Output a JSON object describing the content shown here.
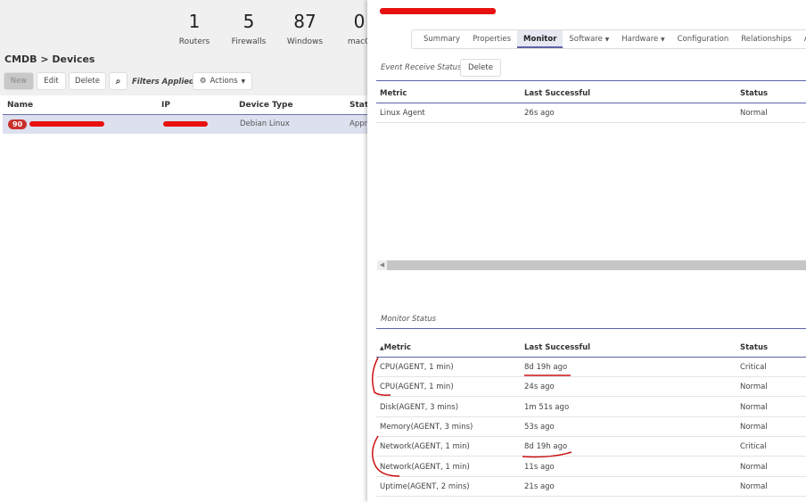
{
  "stats": [
    {
      "value": "1",
      "label": "Routers"
    },
    {
      "value": "5",
      "label": "Firewalls"
    },
    {
      "value": "87",
      "label": "Windows"
    },
    {
      "value": "0",
      "label": "macO"
    }
  ],
  "breadcrumb": "CMDB > Devices",
  "toolbar": {
    "new": "New",
    "edit": "Edit",
    "delete": "Delete",
    "search_icon": "search-icon",
    "filters": "Filters Applied",
    "actions": "Actions"
  },
  "devices": {
    "columns": [
      "Name",
      "IP",
      "Device Type",
      "Statu"
    ],
    "rows": [
      {
        "badge": "90",
        "name": "[redacted]",
        "ip": "[redacted]",
        "type": "Debian Linux",
        "status": "Appr"
      }
    ]
  },
  "detail": {
    "title": "[redacted]",
    "tabs": [
      "Summary",
      "Properties",
      "Monitor",
      "Software",
      "Hardware",
      "Configuration",
      "Relationships",
      "Agent Tem"
    ],
    "active_tab": "Monitor",
    "event": {
      "label": "Event Receive Status",
      "delete": "Delete",
      "columns": [
        "Metric",
        "Last Successful",
        "Status"
      ],
      "rows": [
        [
          "Linux Agent",
          "26s ago",
          "Normal"
        ]
      ]
    },
    "monitor": {
      "label": "Monitor Status",
      "columns": [
        "Metric",
        "Last Successful",
        "Status"
      ],
      "sort": "ascending by Metric",
      "rows": [
        [
          "CPU(AGENT, 1 min)",
          "8d 19h ago",
          "Critical"
        ],
        [
          "CPU(AGENT, 1 min)",
          "24s ago",
          "Normal"
        ],
        [
          "Disk(AGENT, 3 mins)",
          "1m 51s ago",
          "Normal"
        ],
        [
          "Memory(AGENT, 3 mins)",
          "53s ago",
          "Normal"
        ],
        [
          "Network(AGENT, 1 min)",
          "8d 19h ago",
          "Critical"
        ],
        [
          "Network(AGENT, 1 min)",
          "11s ago",
          "Normal"
        ],
        [
          "Uptime(AGENT, 2 mins)",
          "21s ago",
          "Normal"
        ]
      ]
    }
  },
  "colors": {
    "accent": "#5b62a8",
    "badge": "#c9302c",
    "annotation": "#cc1111"
  }
}
